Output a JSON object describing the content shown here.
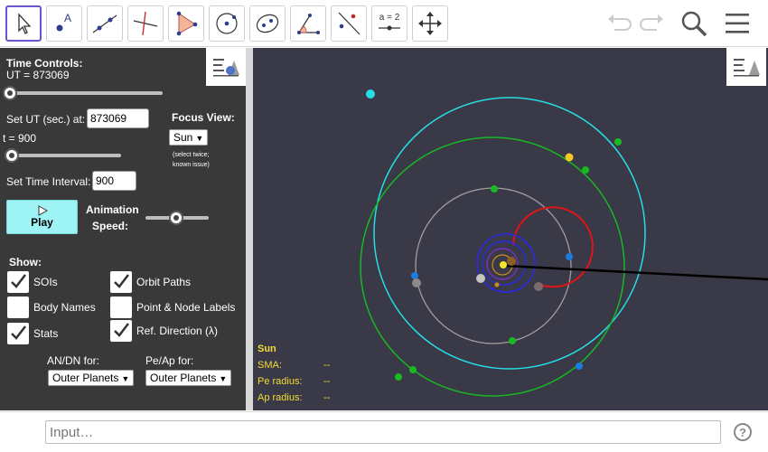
{
  "toolbar": {
    "tools": [
      {
        "name": "move-tool",
        "icon": "cursor-arrow-icon"
      },
      {
        "name": "point-tool",
        "icon": "point-icon",
        "label": "A"
      },
      {
        "name": "line-tool",
        "icon": "line-through-points-icon"
      },
      {
        "name": "perpendicular-line-tool",
        "icon": "perpendicular-line-icon"
      },
      {
        "name": "polygon-tool",
        "icon": "polygon-icon"
      },
      {
        "name": "circle-tool",
        "icon": "circle-center-point-icon"
      },
      {
        "name": "conic-tool",
        "icon": "ellipse-icon"
      },
      {
        "name": "angle-tool",
        "icon": "angle-icon"
      },
      {
        "name": "reflect-tool",
        "icon": "reflect-about-line-icon"
      },
      {
        "name": "slider-tool",
        "icon": "slider-icon",
        "label": "a = 2"
      },
      {
        "name": "move-graphics-tool",
        "icon": "move-graphics-view-icon"
      }
    ],
    "right_icons": [
      "undo-icon",
      "redo-icon",
      "search-icon",
      "menu-icon"
    ]
  },
  "panel": {
    "time_controls_label": "Time Controls:",
    "ut_value_label": "UT = 873069",
    "ut_slider_fraction": 0.0,
    "set_ut_label": "Set UT (sec.) at:",
    "set_ut_value": "873069",
    "focus_view_label": "Focus View:",
    "focus_view_value": "Sun",
    "focus_note_1": "(select twice;",
    "focus_note_2": "known issue)",
    "t_label": "t = 900",
    "t_slider_fraction": 0.0,
    "set_interval_label": "Set Time Interval:",
    "set_interval_value": "900",
    "play_label": "Play",
    "animation_label_1": "Animation",
    "animation_label_2": "Speed:",
    "speed_slider_fraction": 0.5,
    "show_label": "Show:",
    "checkboxes": [
      {
        "label": "SOIs",
        "checked": true
      },
      {
        "label": "Orbit Paths",
        "checked": true
      },
      {
        "label": "Body Names",
        "checked": false
      },
      {
        "label": "Point & Node Labels",
        "checked": false
      },
      {
        "label": "Stats",
        "checked": true
      },
      {
        "label": "Ref. Direction (λ)",
        "checked": true
      }
    ],
    "an_dn_label": "AN/DN for:",
    "an_dn_value": "Outer Planets",
    "pe_ap_label": "Pe/Ap for:",
    "pe_ap_value": "Outer Planets"
  },
  "graphics": {
    "background": "#393947",
    "stats": {
      "body": "Sun",
      "rows": [
        {
          "label": "SMA:",
          "value": "--"
        },
        {
          "label": "Pe radius:",
          "value": "--"
        },
        {
          "label": "Ap radius:",
          "value": "--"
        }
      ],
      "stats_color": "#f5dd33"
    }
  },
  "input_bar": {
    "placeholder": "Input…",
    "help_glyph": "?"
  }
}
